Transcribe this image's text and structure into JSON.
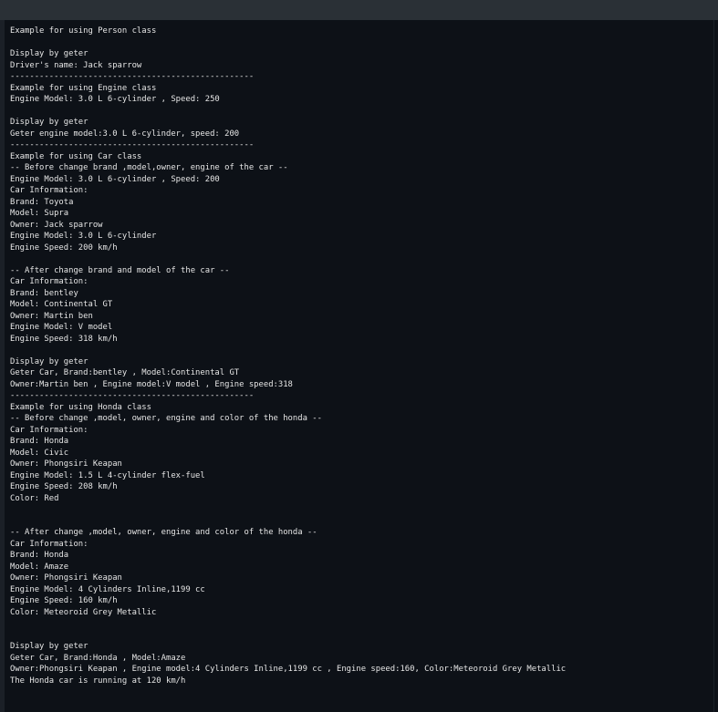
{
  "terminal": {
    "lines": [
      "Example for using Person class",
      "",
      "Display by geter",
      "Driver's name: Jack sparrow",
      "--------------------------------------------------",
      "Example for using Engine class",
      "Engine Model: 3.0 L 6-cylinder , Speed: 250",
      "",
      "Display by geter",
      "Geter engine model:3.0 L 6-cylinder, speed: 200",
      "--------------------------------------------------",
      "Example for using Car class",
      "-- Before change brand ,model,owner, engine of the car --",
      "Engine Model: 3.0 L 6-cylinder , Speed: 200",
      "Car Information:",
      "Brand: Toyota",
      "Model: Supra",
      "Owner: Jack sparrow",
      "Engine Model: 3.0 L 6-cylinder",
      "Engine Speed: 200 km/h",
      "",
      "-- After change brand and model of the car --",
      "Car Information:",
      "Brand: bentley",
      "Model: Continental GT",
      "Owner: Martin ben",
      "Engine Model: V model",
      "Engine Speed: 318 km/h",
      "",
      "Display by geter",
      "Geter Car, Brand:bentley , Model:Continental GT",
      "Owner:Martin ben , Engine model:V model , Engine speed:318",
      "--------------------------------------------------",
      "Example for using Honda class",
      "-- Before change ,model, owner, engine and color of the honda --",
      "Car Information:",
      "Brand: Honda",
      "Model: Civic",
      "Owner: Phongsiri Keapan",
      "Engine Model: 1.5 L 4-cylinder flex-fuel",
      "Engine Speed: 208 km/h",
      "Color: Red",
      "",
      "",
      "-- After change ,model, owner, engine and color of the honda --",
      "Car Information:",
      "Brand: Honda",
      "Model: Amaze",
      "Owner: Phongsiri Keapan",
      "Engine Model: 4 Cylinders Inline,1199 cc",
      "Engine Speed: 160 km/h",
      "Color: Meteoroid Grey Metallic",
      "",
      "",
      "Display by geter",
      "Geter Car, Brand:Honda , Model:Amaze",
      "Owner:Phongsiri Keapan , Engine model:4 Cylinders Inline,1199 cc , Engine speed:160, Color:Meteoroid Grey Metallic",
      "The Honda car is running at 120 km/h"
    ]
  }
}
